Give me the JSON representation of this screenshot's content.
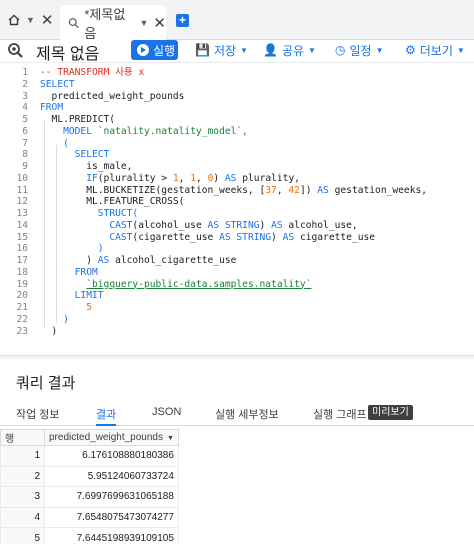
{
  "tabs": {
    "home_icon": "home-icon",
    "doc_tab_label": "*제목없음"
  },
  "toolbar": {
    "title": "제목 없음",
    "run_label": "실행",
    "save_label": "저장",
    "share_label": "공유",
    "schedule_label": "일정",
    "more_label": "더보기"
  },
  "editor": {
    "lines": [
      {
        "n": "1",
        "tokens": [
          {
            "t": "-- TRANSFORM 사용 x",
            "c": "cm"
          }
        ]
      },
      {
        "n": "2",
        "tokens": [
          {
            "t": "SELECT",
            "c": "kw"
          }
        ]
      },
      {
        "n": "3",
        "tokens": [
          {
            "t": "  predicted_weight_pounds",
            "c": ""
          }
        ]
      },
      {
        "n": "4",
        "tokens": [
          {
            "t": "FROM",
            "c": "kw"
          }
        ]
      },
      {
        "n": "5",
        "tokens": [
          {
            "t": "  ML.PREDICT(",
            "c": ""
          }
        ]
      },
      {
        "n": "6",
        "tokens": [
          {
            "t": "    ",
            "c": ""
          },
          {
            "t": "MODEL",
            "c": "kw"
          },
          {
            "t": " `natality.natality_model`,",
            "c": "str"
          }
        ]
      },
      {
        "n": "7",
        "tokens": [
          {
            "t": "    (",
            "c": "kw"
          }
        ]
      },
      {
        "n": "8",
        "tokens": [
          {
            "t": "      ",
            "c": ""
          },
          {
            "t": "SELECT",
            "c": "kw"
          }
        ]
      },
      {
        "n": "9",
        "tokens": [
          {
            "t": "        is_male,",
            "c": ""
          }
        ]
      },
      {
        "n": "10",
        "tokens": [
          {
            "t": "        ",
            "c": ""
          },
          {
            "t": "IF",
            "c": "kw"
          },
          {
            "t": "(plurality > ",
            "c": ""
          },
          {
            "t": "1",
            "c": "num"
          },
          {
            "t": ", ",
            "c": ""
          },
          {
            "t": "1",
            "c": "num"
          },
          {
            "t": ", ",
            "c": ""
          },
          {
            "t": "0",
            "c": "num"
          },
          {
            "t": ") ",
            "c": ""
          },
          {
            "t": "AS",
            "c": "kw"
          },
          {
            "t": " plurality,",
            "c": ""
          }
        ]
      },
      {
        "n": "11",
        "tokens": [
          {
            "t": "        ML.BUCKETIZE(gestation_weeks, [",
            "c": ""
          },
          {
            "t": "37",
            "c": "num"
          },
          {
            "t": ", ",
            "c": ""
          },
          {
            "t": "42",
            "c": "num"
          },
          {
            "t": "]) ",
            "c": ""
          },
          {
            "t": "AS",
            "c": "kw"
          },
          {
            "t": " gestation_weeks,",
            "c": ""
          }
        ]
      },
      {
        "n": "12",
        "tokens": [
          {
            "t": "        ML.FEATURE_CROSS(",
            "c": ""
          }
        ]
      },
      {
        "n": "13",
        "tokens": [
          {
            "t": "          ",
            "c": ""
          },
          {
            "t": "STRUCT(",
            "c": "kw"
          }
        ]
      },
      {
        "n": "14",
        "tokens": [
          {
            "t": "            ",
            "c": ""
          },
          {
            "t": "CAST",
            "c": "kw"
          },
          {
            "t": "(alcohol_use ",
            "c": ""
          },
          {
            "t": "AS STRING",
            "c": "kw"
          },
          {
            "t": ") ",
            "c": ""
          },
          {
            "t": "AS",
            "c": "kw"
          },
          {
            "t": " alcohol_use,",
            "c": ""
          }
        ]
      },
      {
        "n": "15",
        "tokens": [
          {
            "t": "            ",
            "c": ""
          },
          {
            "t": "CAST",
            "c": "kw"
          },
          {
            "t": "(cigarette_use ",
            "c": ""
          },
          {
            "t": "AS STRING",
            "c": "kw"
          },
          {
            "t": ") ",
            "c": ""
          },
          {
            "t": "AS",
            "c": "kw"
          },
          {
            "t": " cigarette_use",
            "c": ""
          }
        ]
      },
      {
        "n": "16",
        "tokens": [
          {
            "t": "          )",
            "c": "kw"
          }
        ]
      },
      {
        "n": "17",
        "tokens": [
          {
            "t": "        ) ",
            "c": ""
          },
          {
            "t": "AS",
            "c": "kw"
          },
          {
            "t": " alcohol_cigarette_use",
            "c": ""
          }
        ]
      },
      {
        "n": "18",
        "tokens": [
          {
            "t": "      ",
            "c": ""
          },
          {
            "t": "FROM",
            "c": "kw"
          }
        ]
      },
      {
        "n": "19",
        "tokens": [
          {
            "t": "        ",
            "c": ""
          },
          {
            "t": "`bigquery-public-data.samples.natality`",
            "c": "str ul"
          }
        ]
      },
      {
        "n": "20",
        "tokens": [
          {
            "t": "      ",
            "c": ""
          },
          {
            "t": "LIMIT",
            "c": "kw"
          }
        ]
      },
      {
        "n": "21",
        "tokens": [
          {
            "t": "        ",
            "c": ""
          },
          {
            "t": "5",
            "c": "num"
          }
        ]
      },
      {
        "n": "22",
        "tokens": [
          {
            "t": "    )",
            "c": "kw"
          }
        ]
      },
      {
        "n": "23",
        "tokens": [
          {
            "t": "  )",
            "c": ""
          }
        ]
      }
    ]
  },
  "results": {
    "title": "쿼리 결과",
    "tabs": [
      "작업 정보",
      "결과",
      "JSON",
      "실행 세부정보",
      "실행 그래프"
    ],
    "active_tab": "결과",
    "preview_badge": "미리보기",
    "columns": [
      "행",
      "predicted_weight_pounds"
    ],
    "rows": [
      [
        "1",
        "6.176108880180386"
      ],
      [
        "2",
        "5.95124060733724"
      ],
      [
        "3",
        "7.6997699631065188"
      ],
      [
        "4",
        "7.6548075473074277"
      ],
      [
        "5",
        "7.6445198939109105"
      ]
    ]
  },
  "colors": {
    "accent": "#1a73e8",
    "keyword": "#1a73e8",
    "comment": "#d93025",
    "number": "#e8710a",
    "string": "#188038"
  }
}
